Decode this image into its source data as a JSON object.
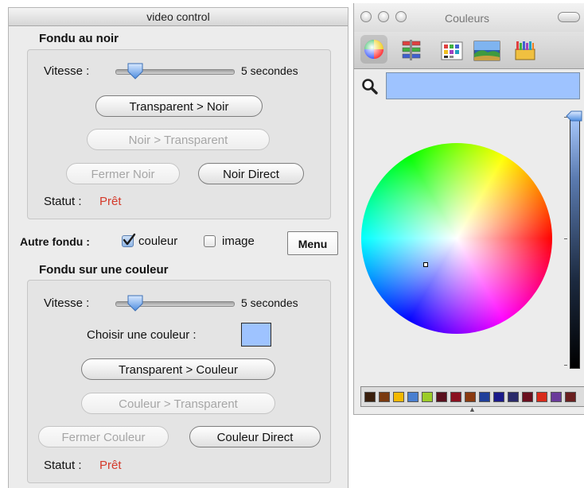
{
  "video_control": {
    "title": "video control",
    "fondu_noir": {
      "title": "Fondu au noir",
      "speed_label": "Vitesse :",
      "speed_value": "5 secondes",
      "speed_fraction": 0.2,
      "btn_transparent_noir": "Transparent > Noir",
      "btn_noir_transparent": "Noir > Transparent",
      "btn_fermer_noir": "Fermer Noir",
      "btn_noir_direct": "Noir Direct",
      "status_label": "Statut :",
      "status_value": "Prêt"
    },
    "autre_fondu": {
      "label": "Autre fondu :",
      "option_couleur": "couleur",
      "option_couleur_checked": true,
      "option_image": "image",
      "option_image_checked": false,
      "menu_button": "Menu"
    },
    "fondu_couleur": {
      "title": "Fondu sur une couleur",
      "speed_label": "Vitesse :",
      "speed_value": "5 secondes",
      "speed_fraction": 0.2,
      "choose_label": "Choisir une couleur :",
      "swatch_color": "#9ec3ff",
      "btn_transparent_couleur": "Transparent > Couleur",
      "btn_couleur_transparent": "Couleur > Transparent",
      "btn_fermer_couleur": "Fermer Couleur",
      "btn_couleur_direct": "Couleur Direct",
      "status_label": "Statut :",
      "status_value": "Prêt"
    }
  },
  "color_panel": {
    "title": "Couleurs",
    "toolbar_icons": [
      "color-wheel-icon",
      "sliders-icon",
      "palettes-icon",
      "image-palette-icon",
      "crayons-icon"
    ],
    "selected_color": "#9ec3ff",
    "brightness_fraction": 1.0,
    "swatches": [
      "#3a1f0d",
      "#7a3a10",
      "#f3b800",
      "#4a7fd0",
      "#9ccc28",
      "#5a0f1e",
      "#8a1020",
      "#8a3a10",
      "#1f3f9a",
      "#1a1a8a",
      "#2a2a6a",
      "#6a0f1f",
      "#d82a1a",
      "#6a3a9a",
      "#6a1f1f"
    ]
  },
  "colors": {
    "status_red": "#d43a2a"
  }
}
